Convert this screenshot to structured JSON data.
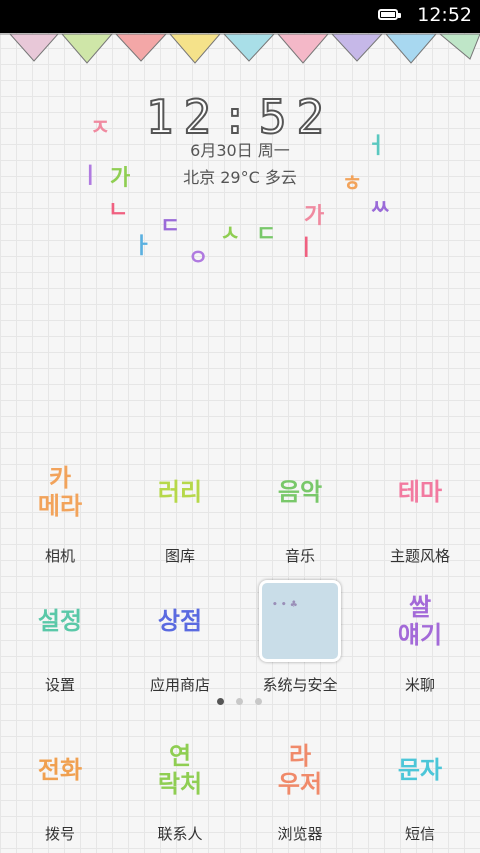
{
  "statusbar": {
    "time": "12:52",
    "battery_icon": "battery-full-icon"
  },
  "clock": {
    "time": "12:52",
    "date": "6月30日 周一",
    "weather": "北京  29°C  多云"
  },
  "apps": [
    {
      "icon_lines": [
        "카",
        "메라"
      ],
      "label": "相机",
      "color": "#f2a35b"
    },
    {
      "icon_lines": [
        "러리"
      ],
      "label": "图库",
      "color": "#b6d84a"
    },
    {
      "icon_lines": [
        "음악"
      ],
      "label": "音乐",
      "color": "#79c86a"
    },
    {
      "icon_lines": [
        "테마"
      ],
      "label": "主题风格",
      "color": "#f27aa0"
    },
    {
      "icon_lines": [
        "설정"
      ],
      "label": "设置",
      "color": "#5ac8a8"
    },
    {
      "icon_lines": [
        "상점"
      ],
      "label": "应用商店",
      "color": "#5a6ae0"
    },
    {
      "icon_lines": [],
      "label": "系统与安全",
      "color": "#c9dde8"
    },
    {
      "icon_lines": [
        "쌀",
        "얘기"
      ],
      "label": "米聊",
      "color": "#a36ad8"
    }
  ],
  "dock": [
    {
      "icon_lines": [
        "전화"
      ],
      "label": "拨号",
      "color": "#f0a050"
    },
    {
      "icon_lines": [
        "연",
        "락처"
      ],
      "label": "联系人",
      "color": "#8fce52"
    },
    {
      "icon_lines": [
        "라",
        "우저"
      ],
      "label": "浏览器",
      "color": "#f08a6a"
    },
    {
      "icon_lines": [
        "문자"
      ],
      "label": "短信",
      "color": "#4cc6d8"
    }
  ],
  "page_indicator": {
    "count": 3,
    "active": 1
  }
}
